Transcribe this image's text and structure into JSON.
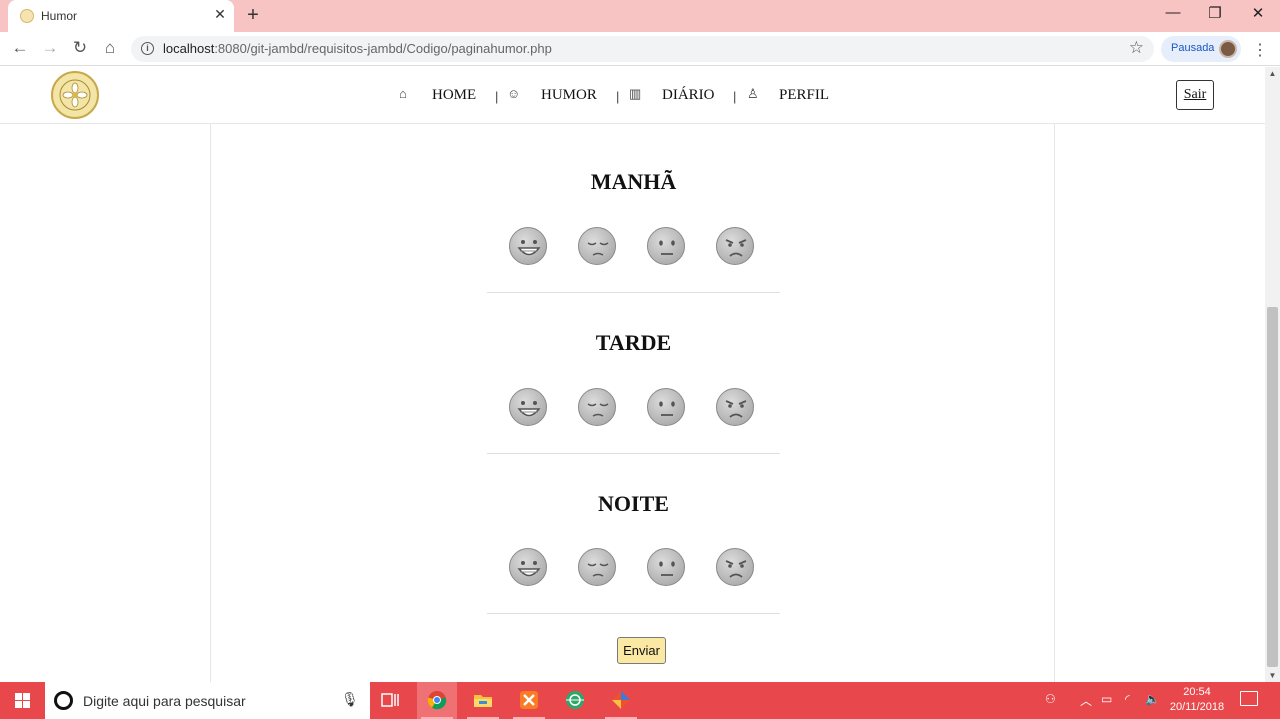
{
  "browser": {
    "tab_title": "Humor",
    "tab_close": "✕",
    "new_tab": "+",
    "url_host": "localhost",
    "url_path": ":8080/git-jambd/requisitos-jambd/Codigo/paginahumor.php",
    "profile_label": "Pausada",
    "window_controls": {
      "minimize": "—",
      "restore": "❐",
      "close": "✕"
    }
  },
  "header": {
    "nav": [
      {
        "label": "HOME",
        "icon": "home-icon"
      },
      {
        "label": "HUMOR",
        "icon": "face-icon"
      },
      {
        "label": "DIÁRIO",
        "icon": "book-icon"
      },
      {
        "label": "PERFIL",
        "icon": "user-icon"
      }
    ],
    "separator": "|",
    "logout_label": "Sair"
  },
  "periods": [
    {
      "title": "MANHÃ",
      "faces": [
        "grinning-face",
        "pensive-face",
        "neutral-face",
        "angry-face"
      ]
    },
    {
      "title": "TARDE",
      "faces": [
        "grinning-face",
        "pensive-face",
        "neutral-face",
        "angry-face"
      ]
    },
    {
      "title": "NOITE",
      "faces": [
        "grinning-face",
        "pensive-face",
        "neutral-face",
        "angry-face"
      ]
    }
  ],
  "submit_label": "Enviar",
  "taskbar": {
    "search_placeholder": "Digite aqui para pesquisar",
    "time": "20:54",
    "date": "20/11/2018"
  },
  "colors": {
    "tabbar": "#f8c3c3",
    "taskbar": "#e8474b",
    "submit_button": "#fbe8a3",
    "emoji_gray": "#b0b0b0"
  }
}
